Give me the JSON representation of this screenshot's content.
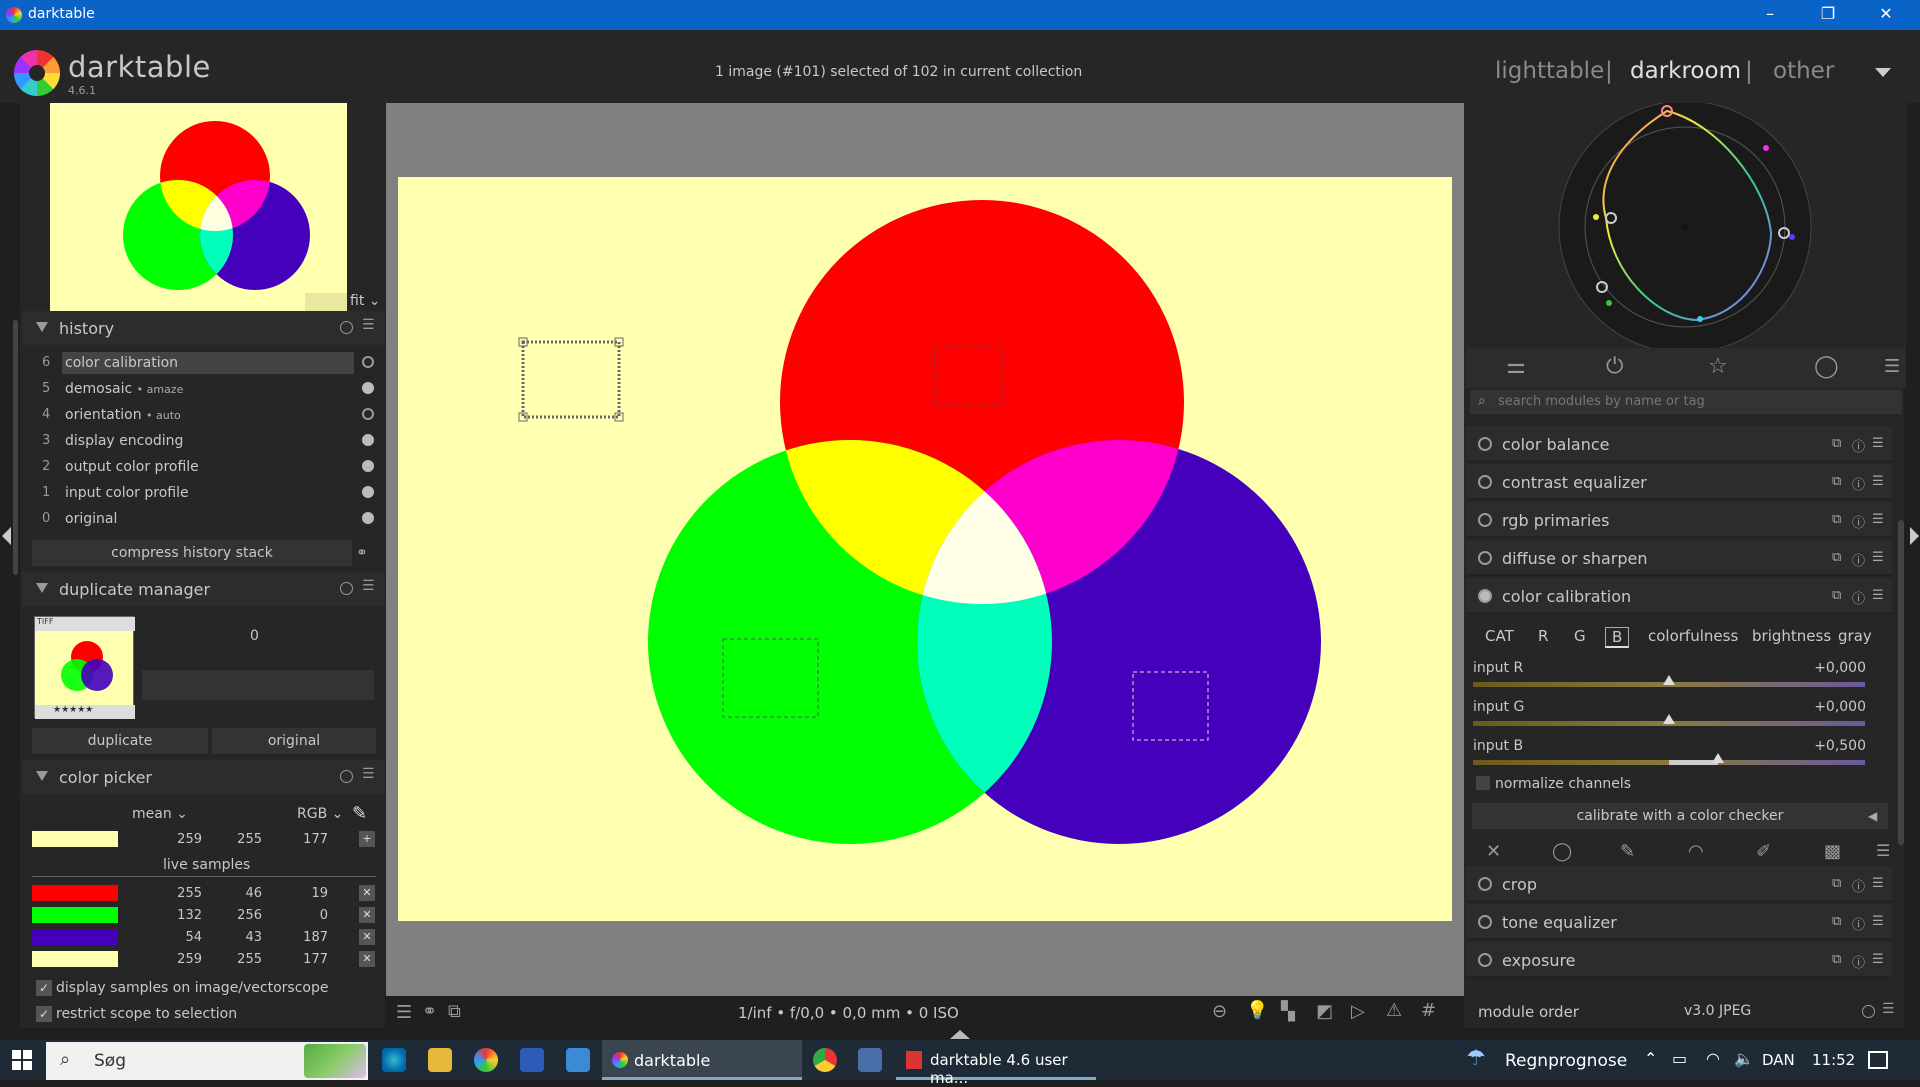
{
  "window": {
    "title": "darktable"
  },
  "app": {
    "name": "darktable",
    "version": "4.6.1"
  },
  "status": "1 image (#101) selected of 102 in current collection",
  "views": {
    "lighttable": "lighttable",
    "darkroom": "darkroom",
    "other": "other",
    "sep": "|"
  },
  "navigation": {
    "zoom": "fit"
  },
  "history": {
    "title": "history",
    "items": [
      {
        "n": "6",
        "label": "color calibration",
        "sub": ""
      },
      {
        "n": "5",
        "label": "demosaic",
        "sub": "• amaze"
      },
      {
        "n": "4",
        "label": "orientation",
        "sub": "• auto"
      },
      {
        "n": "3",
        "label": "display encoding",
        "sub": ""
      },
      {
        "n": "2",
        "label": "output color profile",
        "sub": ""
      },
      {
        "n": "1",
        "label": "input color profile",
        "sub": ""
      },
      {
        "n": "0",
        "label": "original",
        "sub": ""
      }
    ],
    "compress": "compress history stack"
  },
  "duplicate": {
    "title": "duplicate manager",
    "version": "0",
    "thumb_tag": "TIFF",
    "stars": "★★★★★",
    "btn_duplicate": "duplicate",
    "btn_original": "original"
  },
  "picker": {
    "title": "color picker",
    "stat": "mean",
    "model": "RGB",
    "main": {
      "color": "#ffffb0",
      "v": [
        "259",
        "255",
        "177"
      ]
    },
    "live_label": "live samples",
    "samples": [
      {
        "color": "#ff0000",
        "v": [
          "255",
          "46",
          "19"
        ]
      },
      {
        "color": "#00ff00",
        "v": [
          "132",
          "256",
          "0"
        ]
      },
      {
        "color": "#4400bb",
        "v": [
          "54",
          "43",
          "187"
        ]
      },
      {
        "color": "#ffffb0",
        "v": [
          "259",
          "255",
          "177"
        ]
      }
    ],
    "opt1": "display samples on image/vectorscope",
    "opt2": "restrict scope to selection"
  },
  "exif": "1/inf • f/0,0 • 0,0 mm • 0 ISO",
  "search_placeholder": "search modules by name or tag",
  "modules_top": [
    "color balance",
    "contrast equalizer",
    "rgb primaries",
    "diffuse or sharpen",
    "color calibration"
  ],
  "calib": {
    "tabs": [
      "CAT",
      "R",
      "G",
      "B",
      "colorfulness",
      "brightness",
      "gray"
    ],
    "active_tab": "B",
    "sliders": [
      {
        "label": "input R",
        "value": "+0,000",
        "level": 0.0
      },
      {
        "label": "input G",
        "value": "+0,000",
        "level": 0.0
      },
      {
        "label": "input B",
        "value": "+0,500",
        "level": 0.5
      }
    ],
    "normalize": "normalize channels",
    "checker": "calibrate with a color checker"
  },
  "modules_bottom": [
    "crop",
    "tone equalizer",
    "exposure"
  ],
  "module_order": {
    "label": "module order",
    "value": "v3.0 JPEG"
  },
  "taskbar": {
    "search": "Søg",
    "app1": "darktable",
    "app2": "darktable 4.6 user ma...",
    "weather": "Regnprognose",
    "lang": "DAN",
    "time": "11:52"
  }
}
